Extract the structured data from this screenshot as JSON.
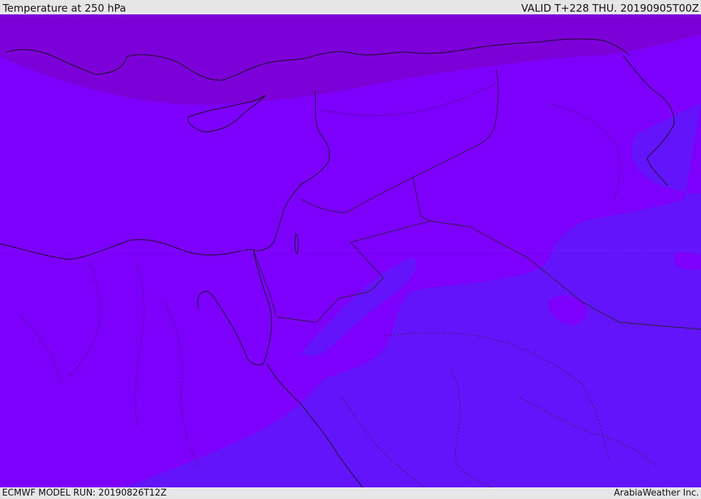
{
  "header": {
    "title": "Temperature at 250 hPa",
    "valid": "VALID T+228 THU. 20190905T00Z"
  },
  "footer": {
    "model_run": "ECMWF MODEL RUN: 20190826T12Z",
    "credit": "ArabiaWeather Inc."
  },
  "map": {
    "colors": {
      "warm_band": "#7c00d8",
      "mid_band": "#7d00fd",
      "cool_band": "#6414fb",
      "coast_line": "#111111",
      "border_line": "#222222"
    }
  }
}
